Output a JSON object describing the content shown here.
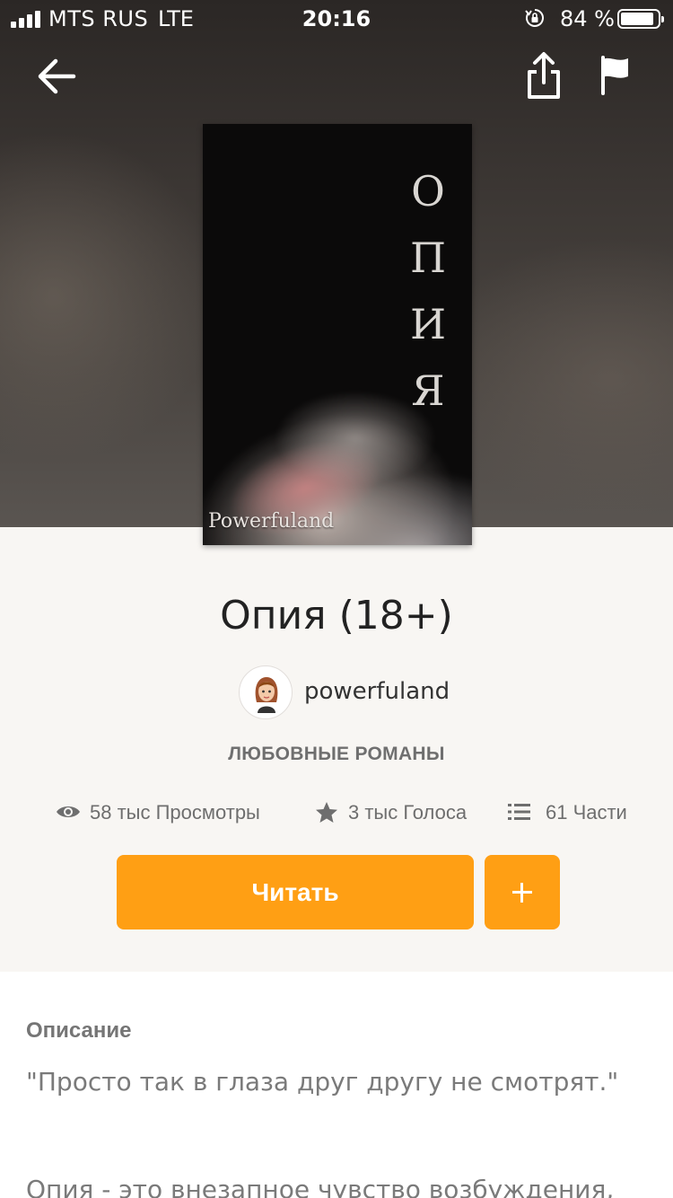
{
  "status_bar": {
    "carrier": "MTS RUS",
    "network": "LTE",
    "time": "20:16",
    "battery": "84 %"
  },
  "cover": {
    "title_letters": [
      "О",
      "П",
      "И",
      "Я"
    ],
    "author": "Powerfuland"
  },
  "story": {
    "title": "Опия (18+)",
    "author": "powerfuland",
    "category": "ЛЮБОВНЫЕ РОМАНЫ"
  },
  "stats": {
    "views": "58 тыс Просмотры",
    "votes": "3 тыс Голоса",
    "parts": "61 Части"
  },
  "actions": {
    "read_label": "Читать",
    "add_label": "+"
  },
  "description": {
    "heading": "Описание",
    "lines": [
      "\"Просто так в глаза друг другу не смотрят.\"",
      "Опия - это внезапное чувство возбуждения,"
    ]
  },
  "colors": {
    "accent": "#ff9f14",
    "page_bg": "#f8f6f3"
  },
  "icons": [
    "back-arrow-icon",
    "share-icon",
    "flag-icon",
    "eye-icon",
    "star-icon",
    "list-icon"
  ]
}
